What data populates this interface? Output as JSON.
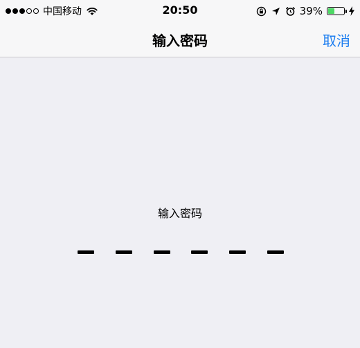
{
  "status_bar": {
    "signal_filled": 3,
    "signal_total": 5,
    "carrier": "中国移动",
    "time": "20:50",
    "battery_percent_text": "39%",
    "battery_level": 0.39,
    "icons": [
      "wifi-icon",
      "orientation-lock-icon",
      "location-arrow-icon",
      "alarm-icon",
      "battery-icon",
      "charging-bolt-icon"
    ],
    "battery_color": "#4cd964"
  },
  "nav": {
    "title": "输入密码",
    "cancel_label": "取消",
    "accent_color": "#1a7cf0"
  },
  "content": {
    "prompt": "输入密码",
    "passcode_length": 6,
    "passcode_entered": 0
  }
}
